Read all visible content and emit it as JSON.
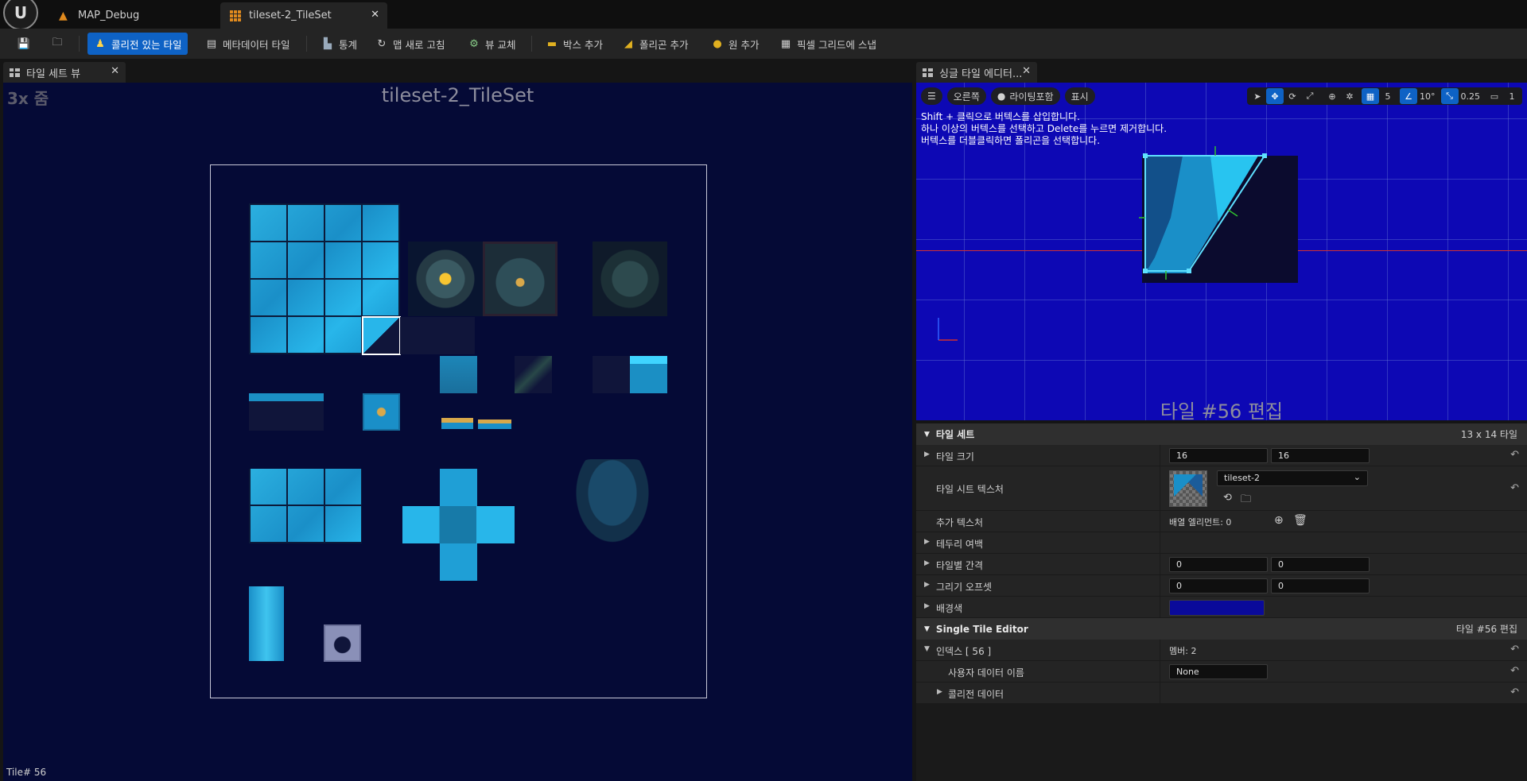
{
  "window": {
    "tabs": [
      {
        "label": "MAP_Debug"
      },
      {
        "label": "tileset-2_TileSet"
      }
    ]
  },
  "toolbar": {
    "collision_tile": "콜리전 있는 타일",
    "metadata_tile": "메타데이터 타일",
    "stats": "통계",
    "refresh_map": "맵 새로 고침",
    "swap_view": "뷰 교체",
    "add_box": "박스 추가",
    "add_polygon": "폴리곤 추가",
    "add_circle": "원 추가",
    "snap_to_grid": "픽셀 그리드에 스냅"
  },
  "tileset_view": {
    "tab_label": "타일 세트 뷰",
    "zoom": "3x 줌",
    "title": "tileset-2_TileSet",
    "status": "Tile# 56"
  },
  "single_tile_editor": {
    "tab_label": "싱글 타일 에디터...",
    "view_mode": "오른쪽",
    "lighting": "라이팅포함",
    "show": "표시",
    "grid_size": "5",
    "angle": "10°",
    "scale": "0.25",
    "camera_speed": "1",
    "hints": [
      "Shift + 클릭으로 버텍스를 삽입합니다.",
      "하나 이상의 버텍스를 선택하고 Delete를 누르면 제거합니다.",
      "버텍스를 더블클릭하면 폴리곤을 선택합니다."
    ],
    "title": "타일 #56 편집"
  },
  "details": {
    "tileset_section": {
      "label": "타일 세트",
      "summary": "13 x 14 타일"
    },
    "tile_size": {
      "label": "타일 크기",
      "x": "16",
      "y": "16"
    },
    "tile_sheet_texture": {
      "label": "타일 시트 텍스처",
      "value": "tileset-2"
    },
    "additional_textures": {
      "label": "추가 텍스처",
      "value": "배열 엘리먼트: 0"
    },
    "margin": {
      "label": "테두리 여백"
    },
    "per_tile_spacing": {
      "label": "타일별 간격",
      "x": "0",
      "y": "0"
    },
    "drawing_offset": {
      "label": "그리기 오프셋",
      "x": "0",
      "y": "0"
    },
    "background_color": {
      "label": "배경색",
      "color": "#0a0a9a"
    },
    "single_tile_section": {
      "label": "Single Tile Editor",
      "summary": "타일 #56 편집"
    },
    "index": {
      "label": "인덱스 [ 56 ]",
      "value": "멤버: 2"
    },
    "user_data_name": {
      "label": "사용자 데이터 이름",
      "value": "None"
    },
    "collision_data": {
      "label": "콜리전 데이터"
    }
  },
  "colors": {
    "accent": "#0e62c5",
    "viewport_bg": "#0d08b4",
    "tileset_bg": "#050a36"
  }
}
